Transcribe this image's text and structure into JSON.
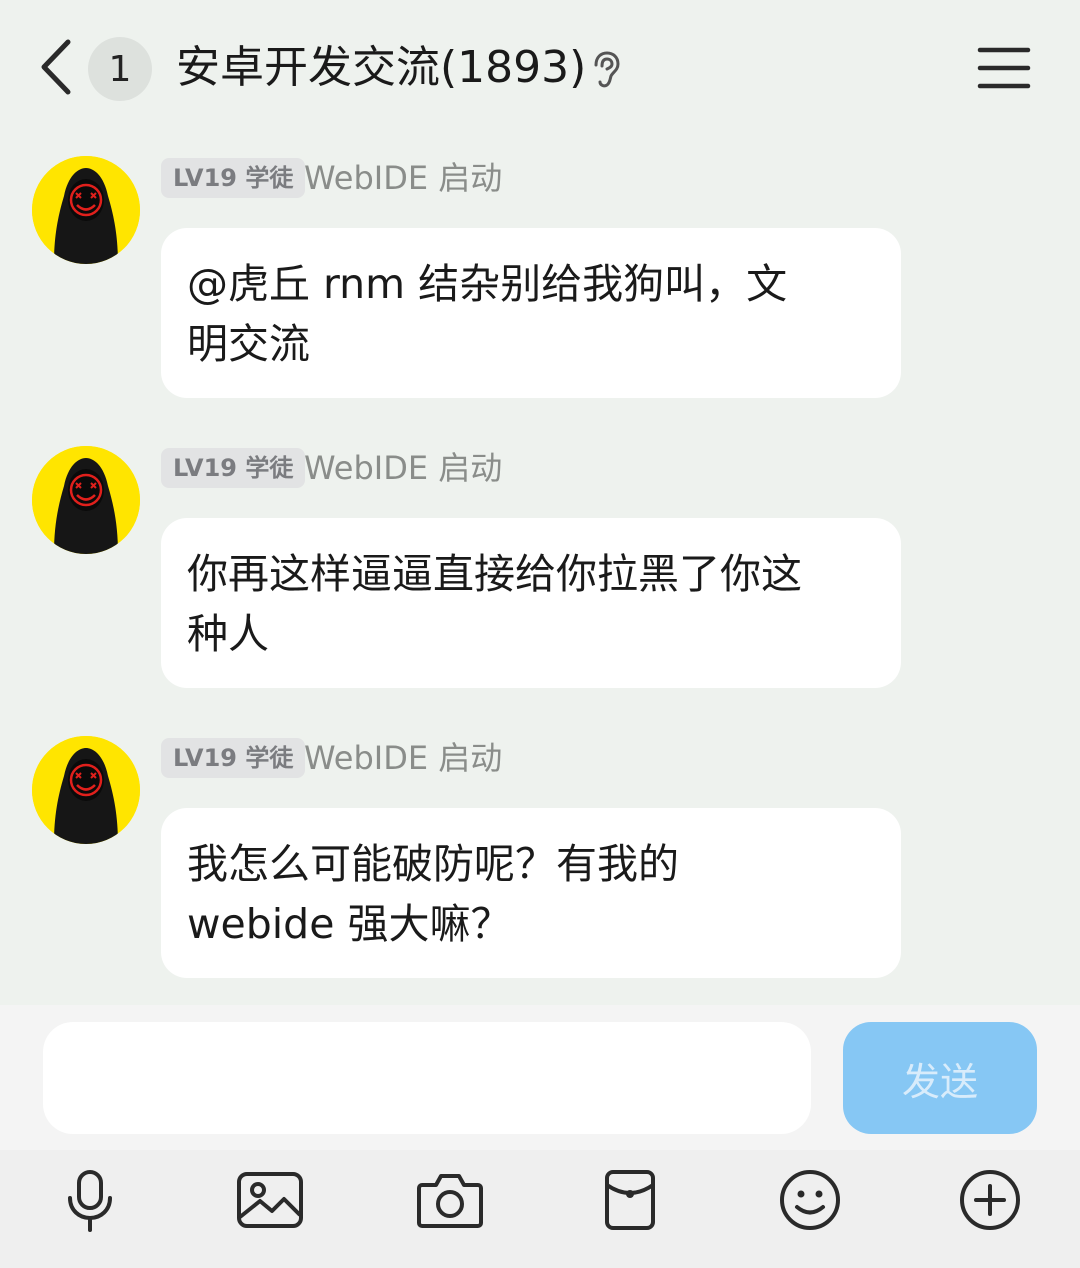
{
  "header": {
    "unread_count": "1",
    "title": "安卓开发交流(1893)"
  },
  "messages": [
    {
      "badge": "LV19 学徒",
      "nickname": "WebIDE 启动",
      "lines": [
        "@虎丘 rnm 结杂别给我狗叫，文",
        "明交流"
      ]
    },
    {
      "badge": "LV19 学徒",
      "nickname": "WebIDE 启动",
      "lines": [
        "你再这样逼逼直接给你拉黑了你这",
        "种人"
      ]
    },
    {
      "badge": "LV19 学徒",
      "nickname": "WebIDE 启动",
      "lines": [
        "我怎么可能破防呢？有我的",
        "webide 强大嘛？"
      ]
    }
  ],
  "composer": {
    "input_value": "",
    "send_label": "发送"
  },
  "toolbar": {
    "icons": [
      "microphone-icon",
      "image-icon",
      "camera-icon",
      "red-packet-icon",
      "emoji-icon",
      "plus-icon"
    ]
  },
  "colors": {
    "background": "#eef2ee",
    "bubble": "#ffffff",
    "send_button": "#86c7f4",
    "avatar_bg": "#ffe500",
    "avatar_mark": "#e0201c"
  }
}
